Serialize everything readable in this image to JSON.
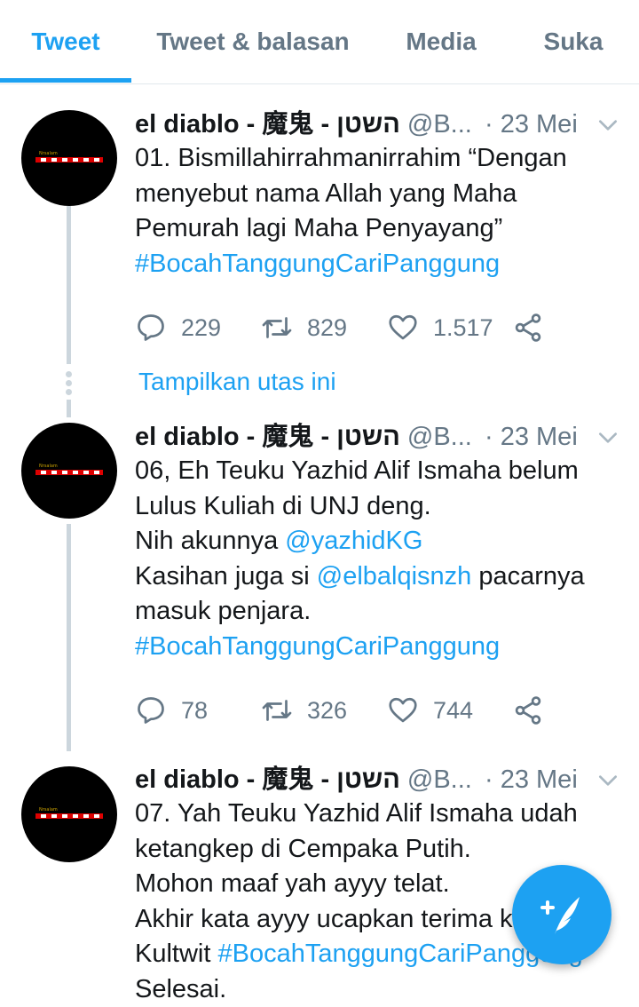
{
  "tabs": [
    {
      "label": "Tweet"
    },
    {
      "label": "Tweet & balasan"
    },
    {
      "label": "Media"
    },
    {
      "label": "Suka"
    }
  ],
  "show_thread": "Tampilkan utas ini",
  "tweets": [
    {
      "name": "el diablo - 魔鬼 - השטן",
      "handle": "@B...",
      "time": "· 23 Mei",
      "lines": [
        {
          "text": "01. Bismillahirrahmanirrahim “Dengan"
        },
        {
          "text": "menyebut nama Allah yang Maha"
        },
        {
          "text": "Pemurah lagi Maha Penyayang”"
        },
        {
          "link": "#BocahTanggungCariPanggung"
        }
      ],
      "replies": "229",
      "retweets": "829",
      "likes": "1.517"
    },
    {
      "name": "el diablo - 魔鬼 - השטן",
      "handle": "@B...",
      "time": "· 23 Mei",
      "lines": [
        {
          "text": "06, Eh Teuku Yazhid Alif Ismaha belum"
        },
        {
          "text": "Lulus Kuliah di UNJ deng."
        },
        {
          "text": "Nih akunnya ",
          "link": "@yazhidKG"
        },
        {
          "text": "Kasihan juga si ",
          "link": "@elbalqisnzh",
          "after": " pacarnya"
        },
        {
          "text": "masuk penjara."
        },
        {
          "link": "#BocahTanggungCariPanggung"
        }
      ],
      "replies": "78",
      "retweets": "326",
      "likes": "744"
    },
    {
      "name": "el diablo - 魔鬼 - השטן",
      "handle": "@B...",
      "time": "· 23 Mei",
      "lines": [
        {
          "text": "07. Yah Teuku Yazhid Alif Ismaha udah"
        },
        {
          "text": "ketangkep di Cempaka Putih."
        },
        {
          "text": "Mohon maaf yah ayyy telat."
        },
        {
          "text": "Akhir kata ayyy ucapkan terima kasih"
        },
        {
          "text": "Kultwit ",
          "link": "#BocahTanggungCariPanggung"
        },
        {
          "text": "Selesai."
        }
      ]
    }
  ],
  "colors": {
    "accent": "#1da1f2",
    "muted": "#657786",
    "thread_line": "#ccd6dd"
  }
}
